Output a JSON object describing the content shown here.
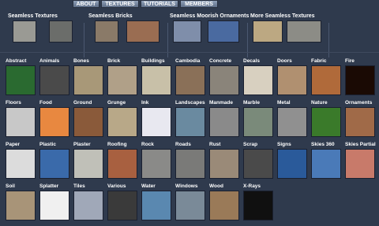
{
  "nav": [
    "ABOUT",
    "TEXTURES",
    "TUTORIALS",
    "MEMBERS"
  ],
  "featured": [
    {
      "title": "Seamless Textures",
      "thumbs": [
        {
          "icon": "concrete-texture",
          "color": "#9a9a94"
        },
        {
          "icon": "stone-texture",
          "color": "#6b6d6a"
        }
      ]
    },
    {
      "title": "Seamless Bricks",
      "thumbs": [
        {
          "icon": "brick-texture",
          "color": "#8a7a68"
        },
        {
          "icon": "brick-texture",
          "color": "#9a6d52"
        }
      ]
    },
    {
      "title": "Seamless Moorish Ornaments",
      "thumbs": [
        {
          "icon": "ornament-texture",
          "color": "#7f8eaa"
        },
        {
          "icon": "ornament-texture",
          "color": "#4a6aa0"
        }
      ]
    },
    {
      "title": "More Seamless Textures",
      "thumbs": [
        {
          "icon": "fabric-texture",
          "color": "#bca882"
        },
        {
          "icon": "rough-texture",
          "color": "#8c8c86"
        }
      ]
    }
  ],
  "categories": [
    {
      "label": "Abstract",
      "color": "#2a6a30",
      "icon": "bokeh-icon"
    },
    {
      "label": "Animals",
      "color": "#4a4a4a",
      "icon": "gorilla-icon"
    },
    {
      "label": "Bones",
      "color": "#a89878",
      "icon": "skull-icon"
    },
    {
      "label": "Brick",
      "color": "#b0a088",
      "icon": "brick-icon"
    },
    {
      "label": "Buildings",
      "color": "#c8c0a8",
      "icon": "building-icon"
    },
    {
      "label": "Cambodia",
      "color": "#8a7058",
      "icon": "statue-icon"
    },
    {
      "label": "Concrete",
      "color": "#8a847a",
      "icon": "concrete-icon"
    },
    {
      "label": "Decals",
      "color": "#d8d0c0",
      "icon": "decal-icon"
    },
    {
      "label": "Doors",
      "color": "#b09070",
      "icon": "door-icon"
    },
    {
      "label": "Fabric",
      "color": "#b06a3a",
      "icon": "fabric-icon"
    },
    {
      "label": "Fire",
      "color": "#1a0a04",
      "icon": "fire-icon"
    },
    {
      "label": "Floors",
      "color": "#c8c8c8",
      "icon": "floor-icon"
    },
    {
      "label": "Food",
      "color": "#e88840",
      "icon": "peach-icon"
    },
    {
      "label": "Ground",
      "color": "#8a5a3a",
      "icon": "ground-icon"
    },
    {
      "label": "Grunge",
      "color": "#b8a888",
      "icon": "grunge-icon"
    },
    {
      "label": "Ink",
      "color": "#e8e8f0",
      "icon": "ink-icon"
    },
    {
      "label": "Landscapes",
      "color": "#6a8aa0",
      "icon": "mountain-icon"
    },
    {
      "label": "Manmade",
      "color": "#8a8a8a",
      "icon": "gauge-icon"
    },
    {
      "label": "Marble",
      "color": "#7a8a7a",
      "icon": "marble-icon"
    },
    {
      "label": "Metal",
      "color": "#909090",
      "icon": "metal-icon"
    },
    {
      "label": "Nature",
      "color": "#3a7a2a",
      "icon": "leaves-icon"
    },
    {
      "label": "Ornaments",
      "color": "#a06a48",
      "icon": "ornament-icon"
    },
    {
      "label": "Paper",
      "color": "#dcdcdc",
      "icon": "paper-icon"
    },
    {
      "label": "Plastic",
      "color": "#3a6aaa",
      "icon": "plastic-icon"
    },
    {
      "label": "Plaster",
      "color": "#c0c0b8",
      "icon": "plaster-icon"
    },
    {
      "label": "Roofing",
      "color": "#a86040",
      "icon": "roof-icon"
    },
    {
      "label": "Rock",
      "color": "#8a8a88",
      "icon": "rock-icon"
    },
    {
      "label": "Roads",
      "color": "#7a7a78",
      "icon": "road-icon"
    },
    {
      "label": "Rust",
      "color": "#9a8a78",
      "icon": "rust-icon"
    },
    {
      "label": "Scrap",
      "color": "#4a4a4a",
      "icon": "scrap-icon"
    },
    {
      "label": "Signs",
      "color": "#2a5a9a",
      "icon": "sign-icon"
    },
    {
      "label": "Skies 360",
      "color": "#4a7ab8",
      "icon": "sky-icon"
    },
    {
      "label": "Skies Partial",
      "color": "#c87a6a",
      "icon": "sunset-icon"
    },
    {
      "label": "Soil",
      "color": "#a89478",
      "icon": "soil-icon"
    },
    {
      "label": "Splatter",
      "color": "#f0f0f0",
      "icon": "splatter-icon"
    },
    {
      "label": "Tiles",
      "color": "#a0a8b8",
      "icon": "tile-icon"
    },
    {
      "label": "Various",
      "color": "#3a3a3a",
      "icon": "various-icon"
    },
    {
      "label": "Water",
      "color": "#5a88b0",
      "icon": "water-icon"
    },
    {
      "label": "Windows",
      "color": "#7a8a98",
      "icon": "window-icon"
    },
    {
      "label": "Wood",
      "color": "#9a7a58",
      "icon": "wood-icon"
    },
    {
      "label": "X-Rays",
      "color": "#101010",
      "icon": "xray-icon"
    }
  ]
}
